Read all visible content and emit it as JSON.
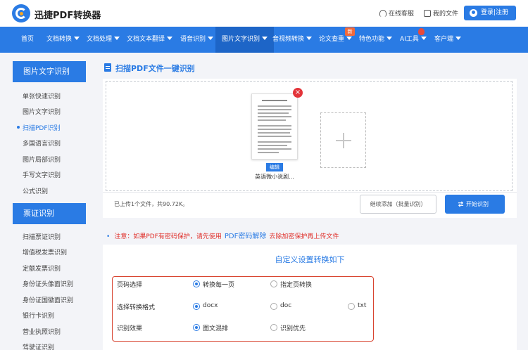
{
  "header": {
    "brand": "迅捷PDF转换器",
    "service": "在线客服",
    "my_files": "我的文件",
    "login": "登录|注册"
  },
  "nav": {
    "items": [
      {
        "label": "首页",
        "dropdown": false
      },
      {
        "label": "文档转换",
        "dropdown": true
      },
      {
        "label": "文档处理",
        "dropdown": true
      },
      {
        "label": "文档文本翻译",
        "dropdown": true
      },
      {
        "label": "语音识别",
        "dropdown": true
      },
      {
        "label": "图片文字识别",
        "dropdown": true,
        "active": true
      },
      {
        "label": "音视频转换",
        "dropdown": true
      },
      {
        "label": "论文查重",
        "dropdown": true
      },
      {
        "label": "特色功能",
        "dropdown": true
      },
      {
        "label": "AI工具",
        "dropdown": true
      },
      {
        "label": "客户端",
        "dropdown": true
      }
    ],
    "new_badge": "新"
  },
  "sidebar": {
    "group1_title": "图片文字识别",
    "group1_items": [
      "单张快速识别",
      "图片文字识别",
      "扫描PDF识别",
      "多国语言识别",
      "图片局部识别",
      "手写文字识别",
      "公式识别"
    ],
    "group2_title": "票证识别",
    "group2_items": [
      "扫描票证识别",
      "增值税发票识别",
      "定额发票识别",
      "身份证头像面识别",
      "身份证国徽面识别",
      "银行卡识别",
      "营业执照识别",
      "驾驶证识别"
    ]
  },
  "main": {
    "title": "扫描PDF文件一键识别",
    "file_name": "英语微小说剧...",
    "edit_label": "编辑",
    "close_glyph": "×",
    "upload_info": "已上传1个文件，共90.72K。",
    "continue_btn": "继续添加（批量识别）",
    "start_btn": "开始识别"
  },
  "notice": {
    "bullet": "•",
    "prefix": "注意：如果PDF有密码保护，请先使用",
    "link": "PDF密码解除",
    "suffix": "去除加密保护再上传文件"
  },
  "settings": {
    "title": "自定义设置转换如下",
    "rows": [
      {
        "label": "页码选择",
        "options": [
          "转换每一页",
          "指定页转换"
        ],
        "selected": 0
      },
      {
        "label": "选择转换格式",
        "options": [
          "docx",
          "doc",
          "txt"
        ],
        "selected": 0
      },
      {
        "label": "识别效果",
        "options": [
          "图文混排",
          "识别优先"
        ],
        "selected": 0
      }
    ]
  },
  "colors": {
    "primary": "#2a7be4",
    "danger": "#e3343a",
    "notice": "#e0322d"
  }
}
